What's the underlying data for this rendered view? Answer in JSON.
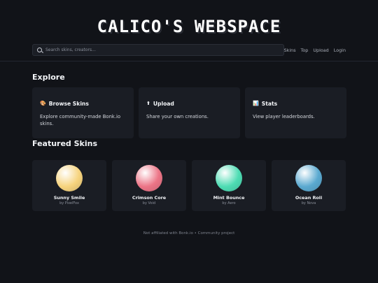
{
  "site": {
    "title": "Calico's Webspace"
  },
  "search": {
    "placeholder": "Search skins, creators..."
  },
  "nav": {
    "items": [
      "Skins",
      "Top",
      "Upload",
      "Login"
    ]
  },
  "explore": {
    "heading": "Explore",
    "cards": [
      {
        "icon": "palette-icon",
        "glyph": "🎨",
        "title": "Browse Skins",
        "description": "Explore community-made Bonk.io skins."
      },
      {
        "icon": "upload-arrow-icon",
        "glyph": "⬆",
        "title": "Upload",
        "description": "Share your own creations."
      },
      {
        "icon": "bar-chart-icon",
        "glyph": "📊",
        "title": "Stats",
        "description": "View player leaderboards."
      }
    ]
  },
  "featured": {
    "heading": "Featured Skins",
    "skins": [
      {
        "name": "Sunny Smile",
        "creator": "by PixelFox",
        "color": "#f6d37d"
      },
      {
        "name": "Crimson Core",
        "creator": "by Void",
        "color": "#ec7486"
      },
      {
        "name": "Mint Bounce",
        "creator": "by Aero",
        "color": "#4ddcb3"
      },
      {
        "name": "Ocean Roll",
        "creator": "by Nova",
        "color": "#5aa9d0"
      }
    ]
  },
  "footer": {
    "text": "Not affiliated with Bonk.io • Community project"
  },
  "theme": {
    "background": "#111318",
    "card": "#1a1d24",
    "text": "#f2f4f7",
    "muted": "#8b909b"
  }
}
